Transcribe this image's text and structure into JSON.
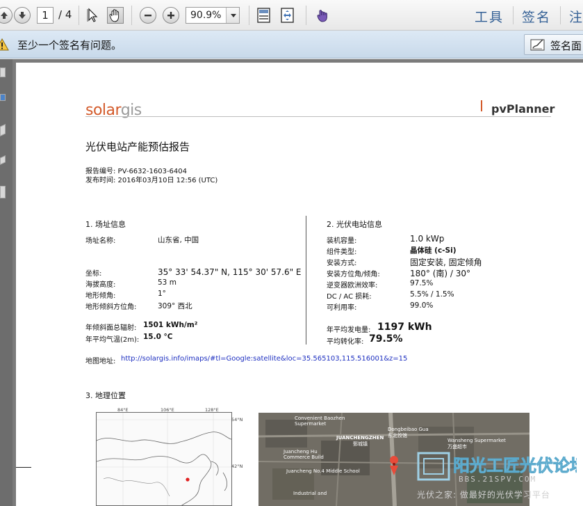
{
  "toolbar": {
    "page_current": "1",
    "page_total": "/ 4",
    "zoom": "90.9%",
    "tools_label": "工具",
    "sign_label": "签名",
    "comment_label_partial": "注"
  },
  "signature_bar": {
    "message": "至少一个签名有问题。",
    "panel_button": "签名面"
  },
  "document": {
    "logo_solar": "solar",
    "logo_gis": "gis",
    "brand": "pvPlanner",
    "title": "光伏电站产能预估报告",
    "report_no": "报告编号: PV-6632-1603-6404",
    "published": "发布时间: 2016年03月10日 12:56 (UTC)",
    "section1": {
      "heading": "1. 场址信息",
      "site_name_label": "场址名称:",
      "site_name_value": "山东省, 中国",
      "coord_label": "坐标:",
      "coord_value": "35° 33' 54.37\" N, 115° 30' 57.6\" E",
      "elev_label": "海拔高度:",
      "elev_value": "53 m",
      "slope_label": "地形倾角:",
      "slope_value": "1°",
      "azim_label": "地形倾斜方位角:",
      "azim_value": "309° 西北",
      "irr_label": "年倾斜面总辐射:",
      "irr_value": "1501 kWh/m²",
      "temp_label": "年平均气温(2m):",
      "temp_value": "15.0 °C"
    },
    "section2": {
      "heading": "2. 光伏电站信息",
      "cap_label": "装机容量:",
      "cap_value": "1.0 kWp",
      "module_label": "组件类型:",
      "module_value": "晶体硅 (c-Si)",
      "mount_label": "安装方式:",
      "mount_value": "固定安装, 固定倾角",
      "orient_label": "安装方位角/倾角:",
      "orient_value": "180° (南) / 30°",
      "inv_label": "逆变器欧洲效率:",
      "inv_value": "97.5%",
      "loss_label": "DC / AC 损耗:",
      "loss_value": "5.5% / 1.5%",
      "avail_label": "可利用率:",
      "avail_value": "99.0%",
      "yield_label": "年平均发电量:",
      "yield_value": "1197 kWh",
      "pr_label": "平均转化率:",
      "pr_value": "79.5%"
    },
    "map_label": "地图地址:",
    "map_url": "http://solargis.info/imaps/#tl=Google:satellite&loc=35.565103,115.516001&z=15",
    "section3": {
      "heading": "3. 地理位置",
      "lon_84": "84°E",
      "lon_106": "106°E",
      "lon_128": "128°E",
      "lat_54": "54°N",
      "lat_42": "42°N",
      "sat_labels": [
        "Convenient Baozhen",
        "Supermarket",
        "Dongbeibao Gua",
        "东北饺馆",
        "JUANCHENGZHEN",
        "鄄城镇",
        "Wansheng Supermarket",
        "万盛超市",
        "Juancheng Hu",
        "Commerce Build",
        "Juancheng No.4 Middle School",
        "Industrial and"
      ]
    }
  },
  "watermark": {
    "logo_text": "阳光工匠光伏论坛",
    "url": "BBS.21SPV.COM",
    "caption": "光伏之家: 做最好的光伏学习平台"
  },
  "colors": {
    "accent_orange": "#d35a2a",
    "link_blue": "#1c2ec0",
    "tool_blue": "#356196"
  }
}
